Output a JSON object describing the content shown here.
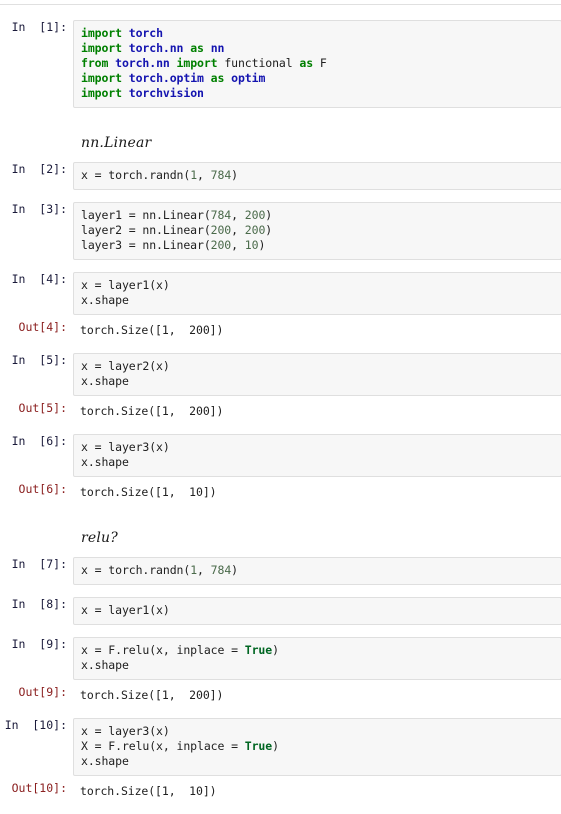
{
  "notebook": {
    "cells": [
      {
        "kind": "code",
        "prompt": "In  [1]:",
        "lines": [
          [
            {
              "t": "import",
              "c": "k"
            },
            {
              "t": " ",
              "c": "p"
            },
            {
              "t": "torch",
              "c": "nn"
            }
          ],
          [
            {
              "t": "import",
              "c": "k"
            },
            {
              "t": " ",
              "c": "p"
            },
            {
              "t": "torch.nn",
              "c": "nn"
            },
            {
              "t": " ",
              "c": "p"
            },
            {
              "t": "as",
              "c": "k"
            },
            {
              "t": " ",
              "c": "p"
            },
            {
              "t": "nn",
              "c": "nn"
            }
          ],
          [
            {
              "t": "from",
              "c": "k"
            },
            {
              "t": " ",
              "c": "p"
            },
            {
              "t": "torch.nn",
              "c": "nn"
            },
            {
              "t": " ",
              "c": "p"
            },
            {
              "t": "import",
              "c": "k"
            },
            {
              "t": " functional ",
              "c": "p"
            },
            {
              "t": "as",
              "c": "k"
            },
            {
              "t": " F",
              "c": "p"
            }
          ],
          [
            {
              "t": "import",
              "c": "k"
            },
            {
              "t": " ",
              "c": "p"
            },
            {
              "t": "torch.optim",
              "c": "nn"
            },
            {
              "t": " ",
              "c": "p"
            },
            {
              "t": "as",
              "c": "k"
            },
            {
              "t": " ",
              "c": "p"
            },
            {
              "t": "optim",
              "c": "nn"
            }
          ],
          [
            {
              "t": "import",
              "c": "k"
            },
            {
              "t": " ",
              "c": "p"
            },
            {
              "t": "torchvision",
              "c": "nn"
            }
          ]
        ]
      },
      {
        "kind": "markdown",
        "text": "nn.Linear"
      },
      {
        "kind": "code",
        "prompt": "In  [2]:",
        "lines": [
          [
            {
              "t": "x = torch.randn(",
              "c": "p"
            },
            {
              "t": "1",
              "c": "n"
            },
            {
              "t": ", ",
              "c": "p"
            },
            {
              "t": "784",
              "c": "n"
            },
            {
              "t": ")",
              "c": "p"
            }
          ]
        ]
      },
      {
        "kind": "code",
        "prompt": "In  [3]:",
        "lines": [
          [
            {
              "t": "layer1 = nn.Linear(",
              "c": "p"
            },
            {
              "t": "784",
              "c": "n"
            },
            {
              "t": ", ",
              "c": "p"
            },
            {
              "t": "200",
              "c": "n"
            },
            {
              "t": ")",
              "c": "p"
            }
          ],
          [
            {
              "t": "layer2 = nn.Linear(",
              "c": "p"
            },
            {
              "t": "200",
              "c": "n"
            },
            {
              "t": ", ",
              "c": "p"
            },
            {
              "t": "200",
              "c": "n"
            },
            {
              "t": ")",
              "c": "p"
            }
          ],
          [
            {
              "t": "layer3 = nn.Linear(",
              "c": "p"
            },
            {
              "t": "200",
              "c": "n"
            },
            {
              "t": ", ",
              "c": "p"
            },
            {
              "t": "10",
              "c": "n"
            },
            {
              "t": ")",
              "c": "p"
            }
          ]
        ]
      },
      {
        "kind": "code",
        "prompt": "In  [4]:",
        "lines": [
          [
            {
              "t": "x = layer1(x)",
              "c": "p"
            }
          ],
          [
            {
              "t": "x.shape",
              "c": "p"
            }
          ]
        ]
      },
      {
        "kind": "output",
        "prompt": "Out[4]:",
        "lines": [
          "torch.Size([1,  200])"
        ]
      },
      {
        "kind": "code",
        "prompt": "In  [5]:",
        "lines": [
          [
            {
              "t": "x = layer2(x)",
              "c": "p"
            }
          ],
          [
            {
              "t": "x.shape",
              "c": "p"
            }
          ]
        ]
      },
      {
        "kind": "output",
        "prompt": "Out[5]:",
        "lines": [
          "torch.Size([1,  200])"
        ]
      },
      {
        "kind": "code",
        "prompt": "In  [6]:",
        "lines": [
          [
            {
              "t": "x = layer3(x)",
              "c": "p"
            }
          ],
          [
            {
              "t": "x.shape",
              "c": "p"
            }
          ]
        ]
      },
      {
        "kind": "output",
        "prompt": "Out[6]:",
        "lines": [
          "torch.Size([1,  10])"
        ]
      },
      {
        "kind": "markdown",
        "text": "relu?"
      },
      {
        "kind": "code",
        "prompt": "In  [7]:",
        "lines": [
          [
            {
              "t": "x = torch.randn(",
              "c": "p"
            },
            {
              "t": "1",
              "c": "n"
            },
            {
              "t": ", ",
              "c": "p"
            },
            {
              "t": "784",
              "c": "n"
            },
            {
              "t": ")",
              "c": "p"
            }
          ]
        ]
      },
      {
        "kind": "code",
        "prompt": "In  [8]:",
        "lines": [
          [
            {
              "t": "x = layer1(x)",
              "c": "p"
            }
          ]
        ]
      },
      {
        "kind": "code",
        "prompt": "In  [9]:",
        "lines": [
          [
            {
              "t": "x = F.relu(x, inplace = ",
              "c": "p"
            },
            {
              "t": "True",
              "c": "kc"
            },
            {
              "t": ")",
              "c": "p"
            }
          ],
          [
            {
              "t": "x.shape",
              "c": "p"
            }
          ]
        ]
      },
      {
        "kind": "output",
        "prompt": "Out[9]:",
        "lines": [
          "torch.Size([1,  200])"
        ]
      },
      {
        "kind": "code",
        "prompt": "In  [10]:",
        "lines": [
          [
            {
              "t": "x = layer3(x)",
              "c": "p"
            }
          ],
          [
            {
              "t": "X = F.relu(x, inplace = ",
              "c": "p"
            },
            {
              "t": "True",
              "c": "kc"
            },
            {
              "t": ")",
              "c": "p"
            }
          ],
          [
            {
              "t": "x.shape",
              "c": "p"
            }
          ]
        ]
      },
      {
        "kind": "output",
        "prompt": "Out[10]:",
        "lines": [
          "torch.Size([1,  10])"
        ]
      }
    ]
  },
  "colors": {
    "keyword": "#008000",
    "module": "#1414b0",
    "number": "#4a6a4a",
    "constant": "#006622",
    "in_prompt": "#1a1a3a",
    "out_prompt": "#8b2020",
    "cell_background": "#f7f7f7",
    "cell_border": "#dfdfdf",
    "page_background": "#ffffff"
  }
}
